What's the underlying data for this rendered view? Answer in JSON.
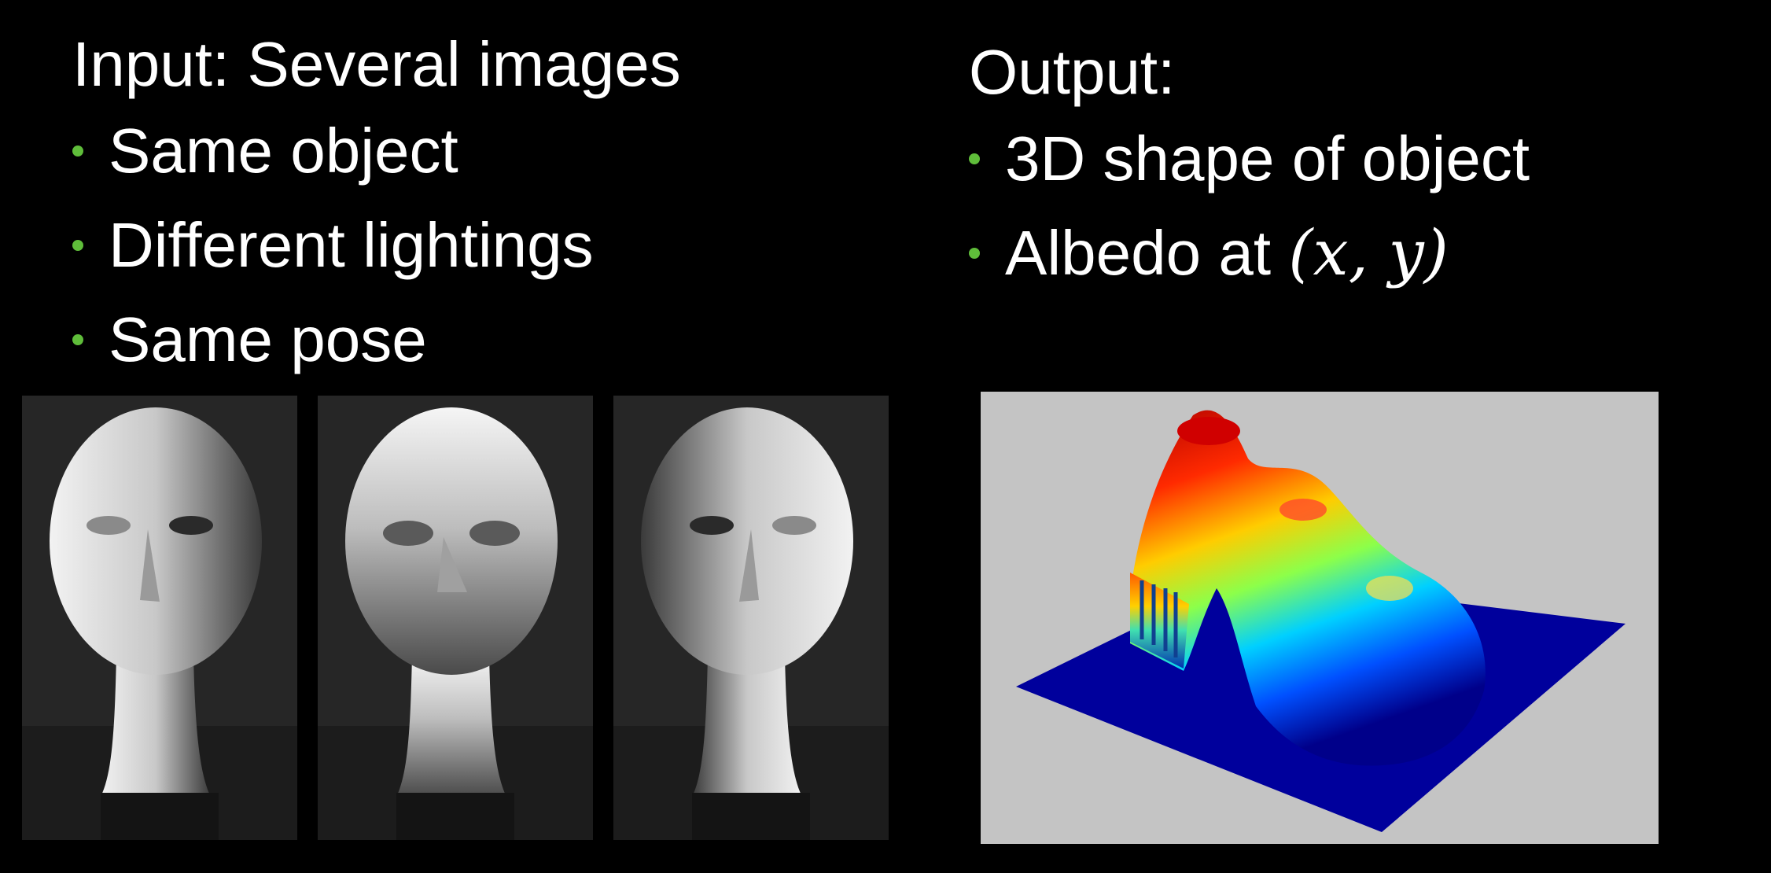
{
  "slide": {
    "input": {
      "heading": "Input: Several images",
      "bullets": [
        "Same object",
        "Different lightings",
        "Same pose"
      ]
    },
    "output": {
      "heading": "Output:",
      "bullets": [
        {
          "text": "3D shape of object"
        },
        {
          "text": "Albedo at ",
          "math": "(x, y)"
        }
      ]
    },
    "bullet_color": "#5fbd3a"
  },
  "images": {
    "photos": [
      {
        "subject": "white mannequin head",
        "light_from": "left"
      },
      {
        "subject": "white mannequin head",
        "light_from": "top"
      },
      {
        "subject": "white mannequin head",
        "light_from": "right"
      }
    ],
    "surface_plot": {
      "subject": "3D reconstructed face surface",
      "colormap": "jet"
    }
  }
}
